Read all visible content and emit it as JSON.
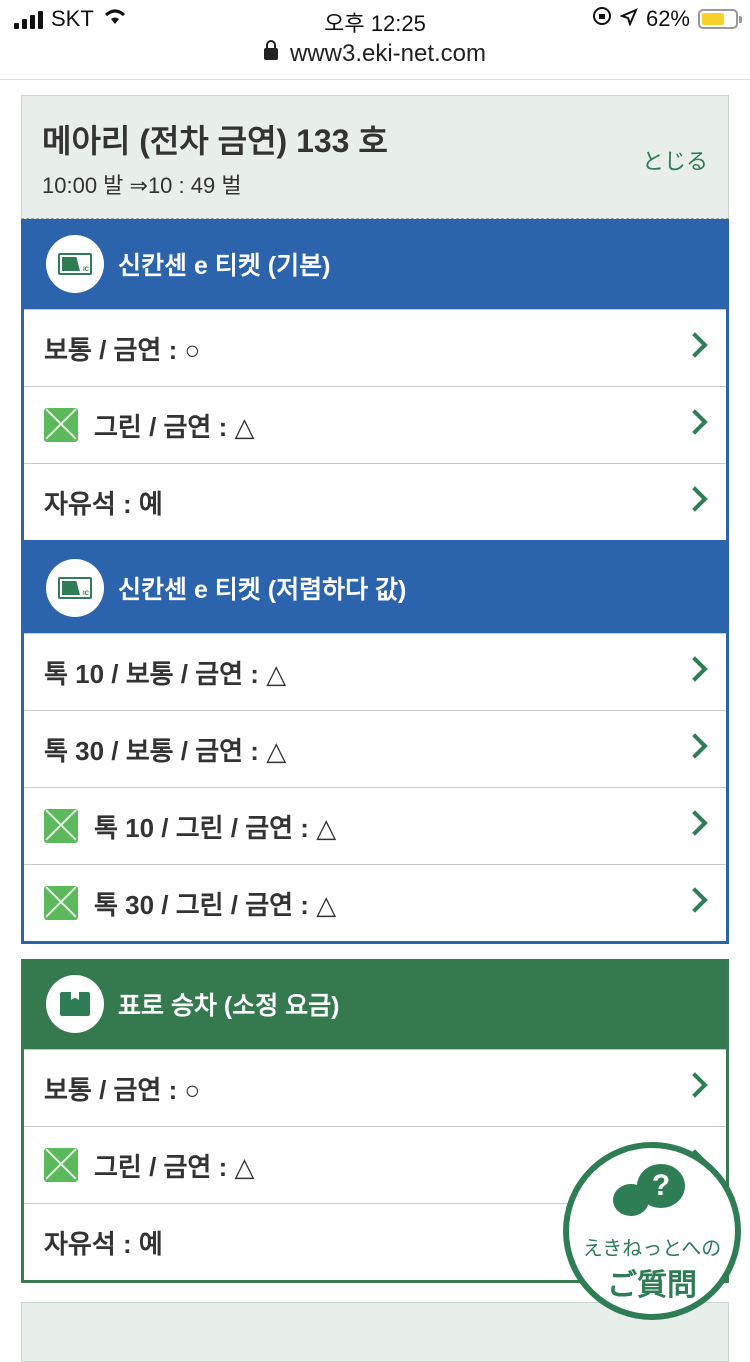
{
  "status_bar": {
    "carrier": "SKT",
    "time": "오후 12:25",
    "battery": "62%",
    "battery_color": "#f7d02c"
  },
  "browser": {
    "url": "www3.eki-net.com"
  },
  "train": {
    "name": "메아리 (전차 금연) 133 호",
    "time": "10:00 발 ⇒10 : 49 벌",
    "close_label": "とじる"
  },
  "sections": [
    {
      "title": "신칸센 e 티켓 (기본)",
      "icon": "ic-card-icon",
      "color": "#2b63ad",
      "rows": [
        {
          "label": "보통 / 금연 : ○",
          "green": false
        },
        {
          "label": "그린 / 금연 : △",
          "green": true
        },
        {
          "label": "자유석 : 예",
          "green": false
        }
      ]
    },
    {
      "title": "신칸센 e 티켓 (저렴하다 값)",
      "icon": "ic-card-icon",
      "color": "#2b63ad",
      "rows": [
        {
          "label": "톡 10 / 보통 / 금연 : △",
          "green": false
        },
        {
          "label": "톡 30 / 보통 / 금연 : △",
          "green": false
        },
        {
          "label": "톡 10 / 그린 / 금연 : △",
          "green": true
        },
        {
          "label": "톡 30 / 그린 / 금연 : △",
          "green": true
        }
      ]
    },
    {
      "title": "표로 승차 (소정 요금)",
      "icon": "ticket-icon",
      "color": "#357a4f",
      "rows": [
        {
          "label": "보통 / 금연 : ○",
          "green": false
        },
        {
          "label": "그린 / 금연 : △",
          "green": true
        },
        {
          "label": "자유석 : 예",
          "green": false
        }
      ]
    }
  ],
  "next_train_partial": "",
  "faq": {
    "line1": "えきねっとへの",
    "line2": "ご質問",
    "symbol": "?"
  }
}
